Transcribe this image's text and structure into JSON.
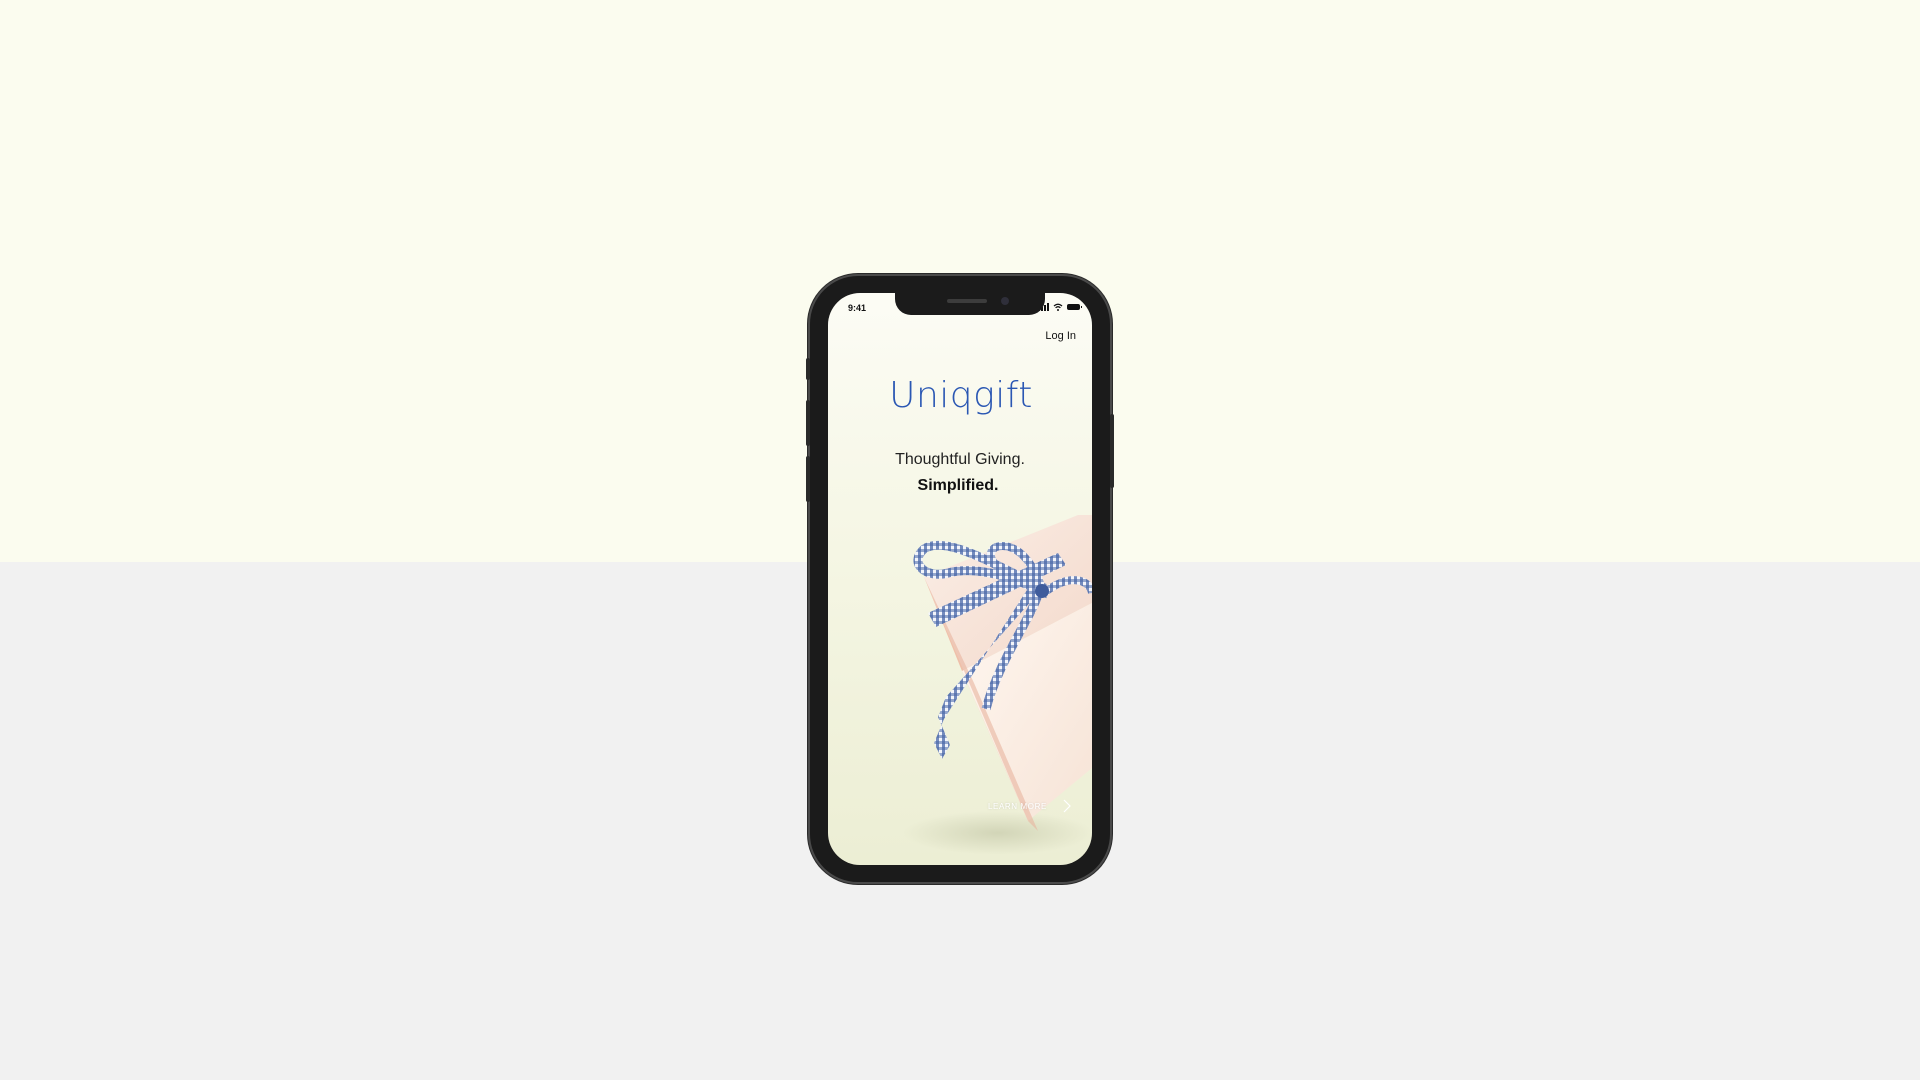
{
  "status_bar": {
    "time": "9:41",
    "icons": [
      "signal-icon",
      "wifi-icon",
      "battery-icon"
    ]
  },
  "header": {
    "login_label": "Log In"
  },
  "hero": {
    "brand": "Uniqgift",
    "tagline_line1": "Thoughtful Giving.",
    "tagline_line2": "Simplified.",
    "image": "gift-box-with-checkered-ribbon"
  },
  "cta": {
    "learn_more_label": "LEARN MORE",
    "icon": "chevron-right-icon"
  },
  "colors": {
    "background_top": "#fbfcef",
    "background_bottom": "#f1f1f1",
    "brand_blue": "#2a57b3",
    "phone_frame": "#1b1b1b"
  }
}
